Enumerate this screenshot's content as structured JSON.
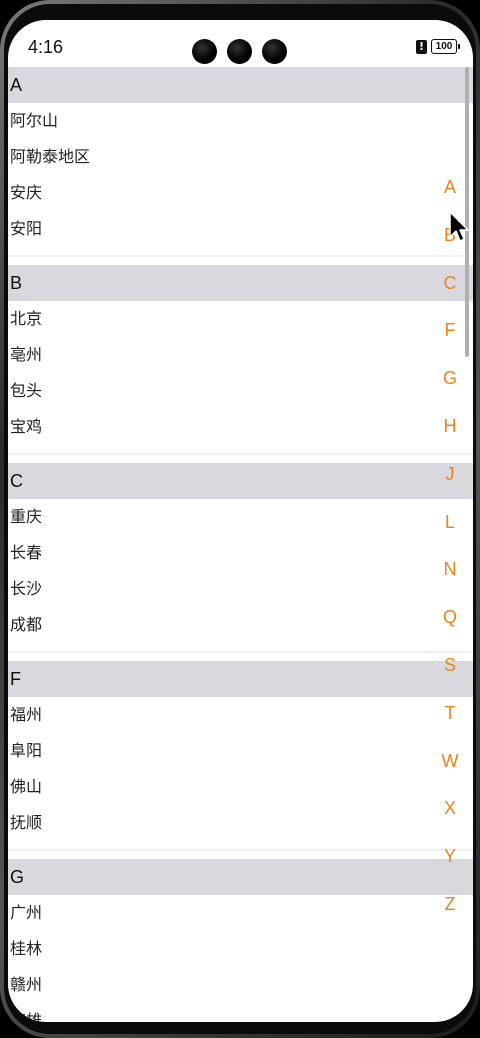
{
  "status_bar": {
    "time": "4:16",
    "alert": "!",
    "battery": "100"
  },
  "sections": [
    {
      "letter": "A",
      "cities": [
        "阿尔山",
        "阿勒泰地区",
        "安庆",
        "安阳"
      ]
    },
    {
      "letter": "B",
      "cities": [
        "北京",
        "亳州",
        "包头",
        "宝鸡"
      ]
    },
    {
      "letter": "C",
      "cities": [
        "重庆",
        "长春",
        "长沙",
        "成都"
      ]
    },
    {
      "letter": "F",
      "cities": [
        "福州",
        "阜阳",
        "佛山",
        "抚顺"
      ]
    },
    {
      "letter": "G",
      "cities": [
        "广州",
        "桂林",
        "赣州",
        "高雄"
      ]
    }
  ],
  "alphabet_index": [
    "A",
    "B",
    "C",
    "F",
    "G",
    "H",
    "J",
    "L",
    "N",
    "Q",
    "S",
    "T",
    "W",
    "X",
    "Y",
    "Z"
  ],
  "colors": {
    "index_accent": "#e8841c",
    "section_header_bg": "#d9d8de"
  }
}
